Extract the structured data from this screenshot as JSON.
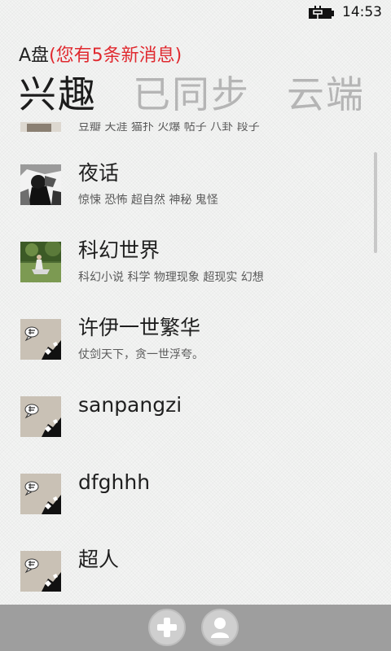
{
  "status": {
    "time": "14:53",
    "battery_icon": "battery-charging-icon"
  },
  "app": {
    "title": "A盘",
    "notice": "(您有5条新消息)"
  },
  "pivot": {
    "tabs": [
      {
        "label": "兴趣",
        "active": true
      },
      {
        "label": "已同步",
        "active": false
      },
      {
        "label": "云端",
        "active": false
      }
    ]
  },
  "list": {
    "items": [
      {
        "title": "",
        "desc": "豆瓣 天涯 猫扑 火爆 帖子 八卦 段子",
        "thumb": "partial-thumbnail"
      },
      {
        "title": "夜话",
        "desc": "惊悚 恐怖 超自然 神秘 鬼怪",
        "thumb": "dark-manga-thumbnail"
      },
      {
        "title": "科幻世界",
        "desc": "科幻小说 科学 物理现象 超现实 幻想",
        "thumb": "photo-thumbnail"
      },
      {
        "title": "许伊一世繁华",
        "desc": "仗剑天下，贪一世浮夸。",
        "thumb": "default-avatar-thumbnail"
      },
      {
        "title": "sanpangzi",
        "desc": "",
        "thumb": "default-avatar-thumbnail"
      },
      {
        "title": "dfghhh",
        "desc": "",
        "thumb": "default-avatar-thumbnail"
      },
      {
        "title": "超人",
        "desc": "",
        "thumb": "default-avatar-thumbnail"
      }
    ]
  },
  "app_bar": {
    "buttons": [
      {
        "icon": "add-icon"
      },
      {
        "icon": "person-icon"
      }
    ]
  },
  "colors": {
    "notice": "#e0292f",
    "inactive_tab": "#b5b5b5",
    "app_bar": "#9e9e9e"
  }
}
